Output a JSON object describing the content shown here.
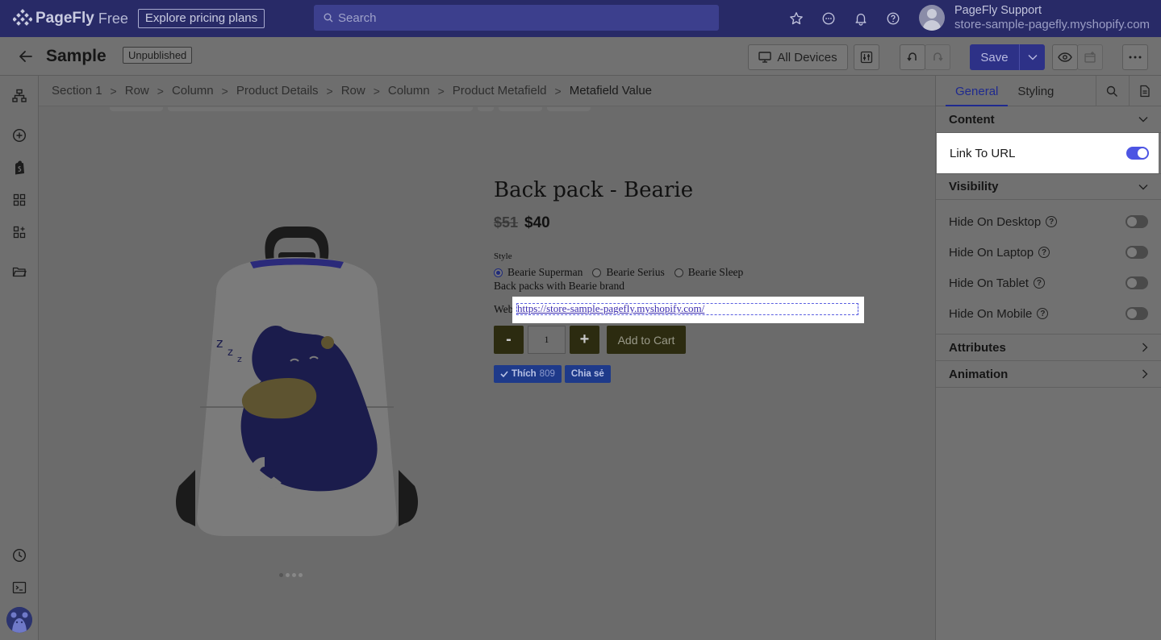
{
  "topbar": {
    "brand": "PageFly",
    "edition": "Free",
    "pricing_label": "Explore pricing plans",
    "search_placeholder": "Search",
    "user_name": "PageFly Support",
    "user_store": "store-sample-pagefly.myshopify.com"
  },
  "subbar": {
    "page_title": "Sample",
    "status": "Unpublished",
    "devices_label": "All Devices",
    "save_label": "Save"
  },
  "breadcrumb": [
    "Section 1",
    "Row",
    "Column",
    "Product Details",
    "Row",
    "Column",
    "Product Metafield",
    "Metafield Value"
  ],
  "product": {
    "title": "Back pack - Bearie",
    "old_price": "$51",
    "price": "$40",
    "style_label": "Style",
    "options": [
      {
        "label": "Bearie Superman",
        "selected": true
      },
      {
        "label": "Bearie Serius",
        "selected": false
      },
      {
        "label": "Bearie Sleep",
        "selected": false
      }
    ],
    "description": "Back packs with Bearie brand",
    "web_label": "Web",
    "web_url": "https://store-sample-pagefly.myshopify.com/",
    "qty_minus": "-",
    "qty_value": "1",
    "qty_plus": "+",
    "add_to_cart": "Add to Cart",
    "like_label": "Thích",
    "like_count": "809",
    "share_label": "Chia sẻ"
  },
  "panel": {
    "tabs": [
      "General",
      "Styling"
    ],
    "sections": {
      "content": "Content",
      "visibility": "Visibility",
      "attributes": "Attributes",
      "animation": "Animation"
    },
    "link_to_url": {
      "label": "Link To URL",
      "on": true
    },
    "visibility_rows": [
      {
        "label": "Hide On Desktop",
        "on": false
      },
      {
        "label": "Hide On Laptop",
        "on": false
      },
      {
        "label": "Hide On Tablet",
        "on": false
      },
      {
        "label": "Hide On Mobile",
        "on": false
      }
    ]
  },
  "colors": {
    "topbar_bg": "#282a67",
    "accent": "#4d55e3",
    "save_bg": "#2d3187"
  }
}
